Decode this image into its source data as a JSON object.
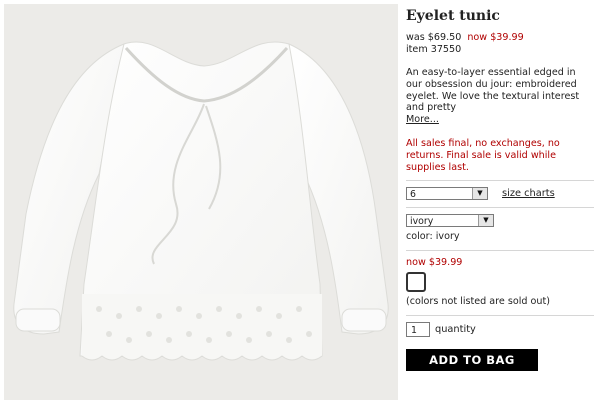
{
  "product": {
    "title": "Eyelet tunic",
    "was_price": "was $69.50",
    "now_price": "now $39.99",
    "item_number": "item 37550",
    "description": "An easy-to-layer essential edged in our obsession du jour: embroidered eyelet. We love the textural interest and pretty",
    "more_link": "More...",
    "sale_notice": "All sales final, no exchanges, no returns. Final sale is valid while supplies last."
  },
  "options": {
    "size_value": "6",
    "size_charts_link": "size charts",
    "color_value": "ivory",
    "color_label": "color: ivory",
    "swatch_price": "now $39.99",
    "sold_out_note": "(colors not listed are sold out)",
    "quantity_value": "1",
    "quantity_label": "quantity",
    "add_to_bag": "ADD TO BAG"
  },
  "icons": {
    "dropdown": "chevron-down-icon"
  },
  "colors": {
    "sale_red": "#b00000",
    "button_bg": "#000000",
    "photo_bg": "#ecebe8"
  }
}
